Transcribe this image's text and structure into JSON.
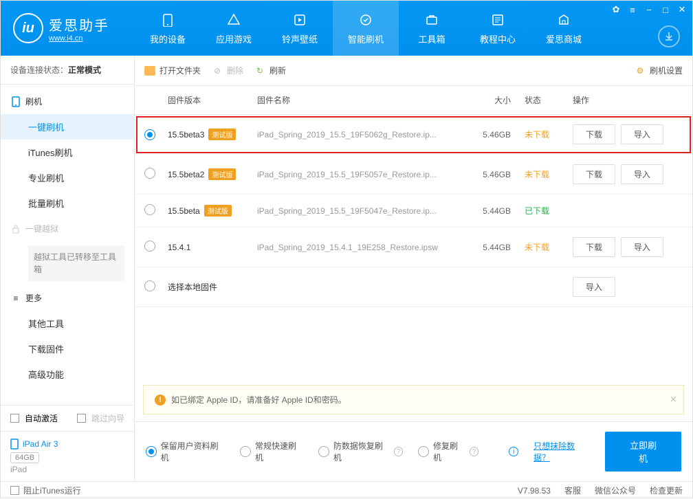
{
  "app": {
    "title": "爱思助手",
    "url": "www.i4.cn"
  },
  "nav": [
    "我的设备",
    "应用游戏",
    "铃声壁纸",
    "智能刷机",
    "工具箱",
    "教程中心",
    "爱思商城"
  ],
  "sidebar": {
    "status_label": "设备连接状态：",
    "status_value": "正常模式",
    "flash": {
      "title": "刷机",
      "items": [
        "一键刷机",
        "iTunes刷机",
        "专业刷机",
        "批量刷机"
      ]
    },
    "jailbreak": {
      "title": "一键越狱",
      "note": "越狱工具已转移至工具箱"
    },
    "more": {
      "title": "更多",
      "items": [
        "其他工具",
        "下载固件",
        "高级功能"
      ]
    },
    "auto_activate": "自动激活",
    "skip_guide": "跳过向导",
    "device": {
      "name": "iPad Air 3",
      "capacity": "64GB",
      "type": "iPad"
    }
  },
  "toolbar": {
    "open": "打开文件夹",
    "delete": "删除",
    "refresh": "刷新",
    "settings": "刷机设置"
  },
  "columns": {
    "version": "固件版本",
    "name": "固件名称",
    "size": "大小",
    "status": "状态",
    "action": "操作"
  },
  "firmware": [
    {
      "ver": "15.5beta3",
      "beta": true,
      "name": "iPad_Spring_2019_15.5_19F5062g_Restore.ip...",
      "size": "5.46GB",
      "status": "未下载",
      "status_cls": "not",
      "selected": true,
      "hl": true,
      "dl": true
    },
    {
      "ver": "15.5beta2",
      "beta": true,
      "name": "iPad_Spring_2019_15.5_19F5057e_Restore.ip...",
      "size": "5.46GB",
      "status": "未下载",
      "status_cls": "not",
      "selected": false,
      "dl": true
    },
    {
      "ver": "15.5beta",
      "beta": true,
      "name": "iPad_Spring_2019_15.5_19F5047e_Restore.ip...",
      "size": "5.44GB",
      "status": "已下载",
      "status_cls": "done",
      "selected": false,
      "dl": false
    },
    {
      "ver": "15.4.1",
      "beta": false,
      "name": "iPad_Spring_2019_15.4.1_19E258_Restore.ipsw",
      "size": "5.44GB",
      "status": "未下载",
      "status_cls": "not",
      "selected": false,
      "dl": true
    }
  ],
  "local_row": "选择本地固件",
  "beta_tag": "测试版",
  "btn": {
    "download": "下载",
    "import": "导入"
  },
  "warning": "如已绑定 Apple ID，请准备好 Apple ID和密码。",
  "options": [
    "保留用户资料刷机",
    "常规快速刷机",
    "防数据恢复刷机",
    "修复刷机"
  ],
  "erase_link": "只想抹除数据？",
  "flash_now": "立即刷机",
  "statusbar": {
    "block": "阻止iTunes运行",
    "version": "V7.98.53",
    "support": "客服",
    "wechat": "微信公众号",
    "update": "检查更新"
  }
}
